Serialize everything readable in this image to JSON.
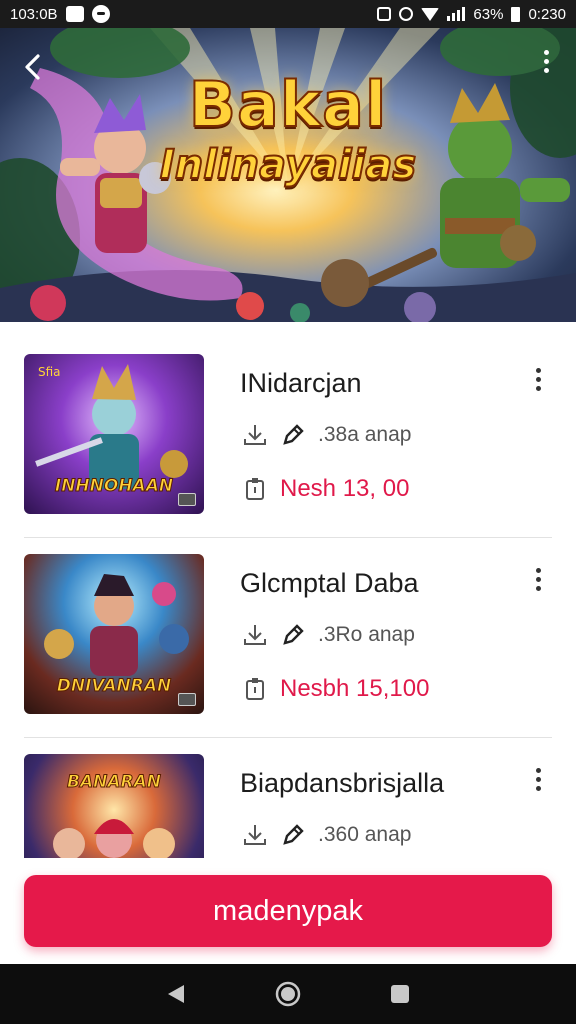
{
  "status_bar": {
    "time_left": "103:0B",
    "battery_percent": "63%",
    "time_right": "0:230"
  },
  "hero": {
    "title_line1": "Bakal",
    "title_line2": "Inlinayaiias"
  },
  "games": [
    {
      "title": "INidarcjan",
      "size": ".38a anap",
      "price": "Nesh 13, 00",
      "thumb_caption": "INHNOHAAN"
    },
    {
      "title": "Glcmptal Daba",
      "size": ".3Ro anap",
      "price": "Nesbh 15,100",
      "thumb_caption": "DNIVANRAN"
    },
    {
      "title": "Biapdansbrisjalla",
      "size": ".360 anap",
      "price": "",
      "thumb_caption": "BANARAN"
    }
  ],
  "primary_action": {
    "label": "madenypak"
  },
  "colors": {
    "accent": "#e5194a",
    "status_bar": "#1b1b1b",
    "nav_bar": "#0d0d0d"
  },
  "icons": {
    "back": "chevron-left-icon",
    "more": "more-vertical-icon",
    "download": "download-icon",
    "edit": "pen-icon",
    "price": "tag-icon",
    "nav_back": "triangle-back-icon",
    "nav_home": "circle-home-icon",
    "nav_recent": "square-recent-icon"
  }
}
